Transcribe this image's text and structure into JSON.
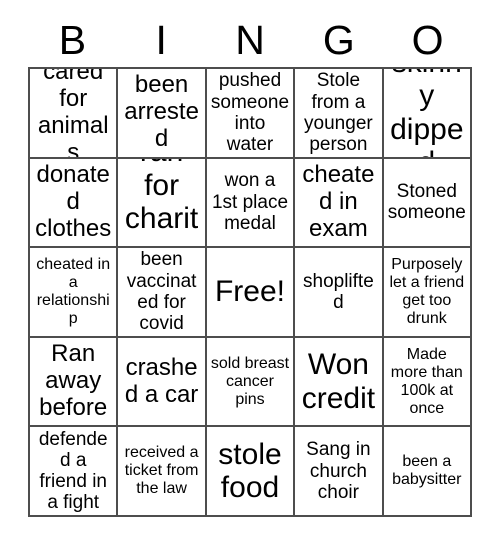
{
  "card": {
    "title": "BINGO",
    "header_letters": [
      "B",
      "I",
      "N",
      "G",
      "O"
    ],
    "grid_size": "5x5",
    "free_space": "Free!",
    "colors": {
      "background": "#ffffff",
      "text": "#000000",
      "border": "#4d4d4d"
    },
    "rows": [
      [
        {
          "text": "cared for animals",
          "size": "fs-lg"
        },
        {
          "text": "been arrested",
          "size": "fs-lg"
        },
        {
          "text": "pushed someone into water",
          "size": "fs-md"
        },
        {
          "text": "Stole from a younger person",
          "size": "fs-md"
        },
        {
          "text": "skinny dipped",
          "size": "fs-xl"
        }
      ],
      [
        {
          "text": "donated clothes",
          "size": "fs-lg"
        },
        {
          "text": "ran for charity",
          "size": "fs-xl"
        },
        {
          "text": "won a 1st place medal",
          "size": "fs-md"
        },
        {
          "text": "cheated in exam",
          "size": "fs-lg"
        },
        {
          "text": "Stoned someone",
          "size": "fs-md"
        }
      ],
      [
        {
          "text": "cheated in a relationship",
          "size": "fs-sm"
        },
        {
          "text": "been vaccinated for covid",
          "size": "fs-md"
        },
        {
          "text": "Free!",
          "size": "fs-xl"
        },
        {
          "text": "shoplifted",
          "size": "fs-md"
        },
        {
          "text": "Purposely let a friend get too drunk",
          "size": "fs-sm"
        }
      ],
      [
        {
          "text": "Ran away before",
          "size": "fs-lg"
        },
        {
          "text": "crashed a car",
          "size": "fs-lg"
        },
        {
          "text": "sold breast cancer pins",
          "size": "fs-sm"
        },
        {
          "text": "Won credit",
          "size": "fs-xl"
        },
        {
          "text": "Made more than 100k at once",
          "size": "fs-sm"
        }
      ],
      [
        {
          "text": "defended a friend in a fight",
          "size": "fs-md"
        },
        {
          "text": "received a ticket from the law",
          "size": "fs-sm"
        },
        {
          "text": "stole food",
          "size": "fs-xl"
        },
        {
          "text": "Sang in church choir",
          "size": "fs-md"
        },
        {
          "text": "been a babysitter",
          "size": "fs-sm"
        }
      ]
    ]
  }
}
